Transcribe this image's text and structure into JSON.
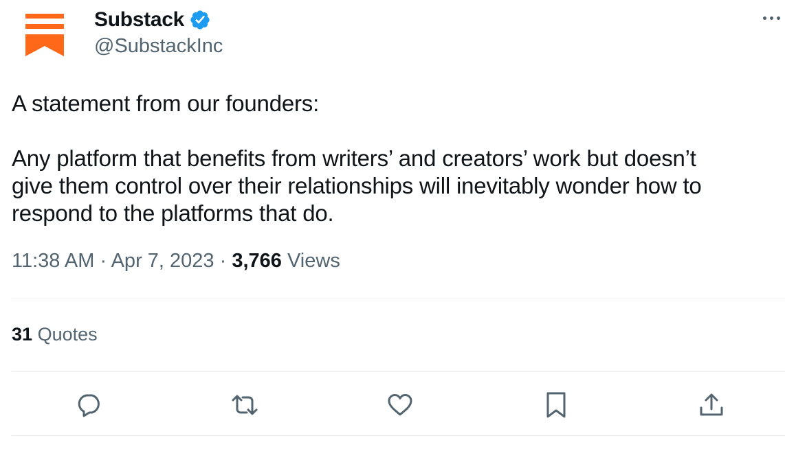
{
  "account": {
    "display_name": "Substack",
    "handle": "@SubstackInc",
    "verified": true,
    "brand_color": "#ff6719",
    "verified_color": "#1d9bf0"
  },
  "tweet": {
    "lines": [
      "A statement from our founders:",
      "Any platform that benefits from writers’ and creators’ work but doesn’t",
      "give them control over their relationships will inevitably wonder how to",
      "respond to the platforms that do."
    ],
    "time": "11:38 AM",
    "separator": "·",
    "date": "Apr 7, 2023",
    "views_count": "3,766",
    "views_label": "Views"
  },
  "stats": {
    "quotes_count": "31",
    "quotes_label": "Quotes"
  },
  "actions": [
    {
      "name": "reply",
      "icon": "reply-icon"
    },
    {
      "name": "retweet",
      "icon": "retweet-icon"
    },
    {
      "name": "like",
      "icon": "heart-icon"
    },
    {
      "name": "bookmark",
      "icon": "bookmark-icon"
    },
    {
      "name": "share",
      "icon": "share-icon"
    }
  ],
  "colors": {
    "text_primary": "#0f1419",
    "text_secondary": "#536471",
    "divider": "#eff3f4"
  }
}
